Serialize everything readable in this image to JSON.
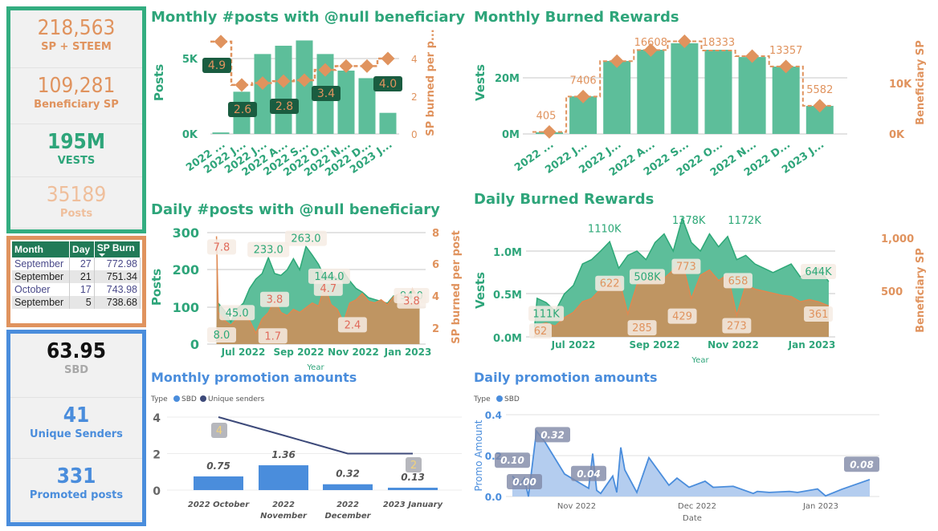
{
  "kpis_top": [
    {
      "value": "218,563",
      "label": "SP + STEEM",
      "color": "#e0935e"
    },
    {
      "value": "109,281",
      "label": "Beneficiary SP",
      "color": "#e0935e"
    },
    {
      "value": "195M",
      "label": "VESTS",
      "color": "#2ea57a"
    },
    {
      "value": "35189",
      "label": "Posts",
      "color": "#efbf9c"
    }
  ],
  "table": {
    "headers": [
      "Month",
      "Day",
      "SP Burn"
    ],
    "sort_icon": "sort-down-icon",
    "rows": [
      [
        "September",
        "27",
        "772.98"
      ],
      [
        "September",
        "21",
        "751.34"
      ],
      [
        "October",
        "17",
        "743.98"
      ],
      [
        "September",
        "5",
        "738.68"
      ]
    ]
  },
  "kpis_bottom": [
    {
      "value": "63.95",
      "label": "SBD",
      "color": "#111111",
      "label_color": "#a8a8a8"
    },
    {
      "value": "41",
      "label": "Unique Senders",
      "color": "#4a8ddc",
      "label_color": "#4a8ddc"
    },
    {
      "value": "331",
      "label": "Promoted posts",
      "color": "#4a8ddc",
      "label_color": "#4a8ddc"
    }
  ],
  "colors": {
    "green": "#5dbe9a",
    "dark_green": "#2ea57a",
    "orange": "#e0935e",
    "blue": "#4a8ddc",
    "navy": "#3d4a7a"
  },
  "chart_data": [
    {
      "type": "bar",
      "title": "Monthly #posts with @null beneficiary",
      "ylabel": "Posts",
      "y2label": "SP burned per p...",
      "categories": [
        "2022 ...",
        "2022 J...",
        "2022 J...",
        "2022 A...",
        "2022 S...",
        "2022 O...",
        "2022 N...",
        "2022 D...",
        "2023 J..."
      ],
      "yticks": [
        "0K",
        "5K"
      ],
      "y2ticks": [
        "0",
        "2",
        "4"
      ],
      "series": [
        {
          "type": "bar",
          "values_k": [
            0.1,
            2.8,
            5.3,
            5.85,
            6.2,
            5.3,
            4.2,
            3.7,
            1.4
          ]
        },
        {
          "type": "step-line",
          "axis": "right",
          "values": [
            4.9,
            2.6,
            2.7,
            2.8,
            2.85,
            3.4,
            3.6,
            3.6,
            4.0
          ],
          "labels": [
            "4.9",
            "2.6",
            null,
            "2.8",
            null,
            "3.4",
            null,
            null,
            "4.0"
          ]
        }
      ]
    },
    {
      "type": "bar",
      "title": "Monthly Burned Rewards",
      "ylabel": "Vests",
      "y2label": "Beneficiary SP",
      "categories": [
        "2022 ...",
        "2022 J...",
        "2022 J...",
        "2022 A...",
        "2022 S...",
        "2022 O...",
        "2022 N...",
        "2022 D...",
        "2023 J..."
      ],
      "yticks": [
        "0M",
        "20M"
      ],
      "y2ticks": [
        "0K",
        "10K"
      ],
      "series": [
        {
          "type": "bar",
          "values_m": [
            0.6,
            13.4,
            26,
            30,
            32.3,
            30,
            27.4,
            24,
            10
          ]
        },
        {
          "type": "step-line",
          "axis": "right",
          "values": [
            405,
            7406,
            14400,
            16608,
            18333,
            16500,
            15400,
            13357,
            5582
          ],
          "labels": [
            "405",
            "7406",
            null,
            "16608",
            null,
            "18333",
            null,
            "13357",
            "5582"
          ]
        }
      ]
    },
    {
      "type": "area",
      "title": "Daily #posts with @null beneficiary",
      "ylabel": "Posts",
      "y2label": "SP burned per post",
      "xlabel": "Year",
      "xticks": [
        "Jul 2022",
        "Sep 2022",
        "Nov 2022",
        "Jan 2023"
      ],
      "yticks": [
        "0",
        "100",
        "200",
        "300"
      ],
      "y2ticks": [
        "2",
        "4",
        "6",
        "8"
      ],
      "dates": [
        "2022-06-01",
        "2022-06-03",
        "2022-06-10",
        "2022-06-17",
        "2022-06-24",
        "2022-07-01",
        "2022-07-08",
        "2022-07-15",
        "2022-07-22",
        "2022-07-29",
        "2022-08-05",
        "2022-08-12",
        "2022-08-19",
        "2022-08-26",
        "2022-09-02",
        "2022-09-09",
        "2022-09-16",
        "2022-09-23",
        "2022-09-30",
        "2022-10-07",
        "2022-10-14",
        "2022-10-21",
        "2022-10-28",
        "2022-11-04",
        "2022-11-11",
        "2022-11-18",
        "2022-11-25",
        "2022-12-02",
        "2022-12-09",
        "2022-12-16",
        "2022-12-23",
        "2022-12-30",
        "2023-01-06",
        "2023-01-14"
      ],
      "series": [
        {
          "name": "Posts",
          "values": [
            8,
            110,
            90,
            60,
            95,
            110,
            150,
            175,
            190,
            233,
            190,
            185,
            200,
            230,
            200,
            263,
            240,
            215,
            180,
            190,
            175,
            195,
            170,
            150,
            140,
            125,
            120,
            115,
            110,
            130,
            120,
            110,
            100,
            94
          ]
        },
        {
          "name": "SP burned per post",
          "axis": "right",
          "values": [
            7.8,
            3.0,
            2.5,
            2.2,
            2.6,
            2.8,
            2.5,
            1.7,
            2.6,
            3.0,
            3.8,
            3.0,
            2.8,
            3.2,
            3.0,
            3.3,
            3.6,
            3.4,
            4.7,
            3.5,
            3.2,
            2.4,
            3.6,
            3.8,
            4.2,
            3.7,
            3.6,
            3.8,
            3.5,
            4.0,
            4.2,
            3.6,
            4.5,
            3.8
          ]
        }
      ],
      "data_labels": [
        {
          "series": 0,
          "date": "2022-06-03",
          "value": 15,
          "text": "8.0"
        },
        {
          "series": 0,
          "date": "2022-06-24",
          "value": 75,
          "text": "45.0"
        },
        {
          "series": 0,
          "date": "2022-07-29",
          "value": 245,
          "text": "233.0"
        },
        {
          "series": 0,
          "date": "2022-09-09",
          "value": 275,
          "text": "263.0"
        },
        {
          "series": 0,
          "date": "2022-10-05",
          "value": 173,
          "text": "144.0"
        },
        {
          "series": 0,
          "date": "2023-01-05",
          "value": 121,
          "text": "94.0"
        },
        {
          "series": 1,
          "date": "2022-06-03",
          "value": 6.9,
          "text": "7.8"
        },
        {
          "series": 1,
          "date": "2022-08-03",
          "value": 1.3,
          "text": "1.7"
        },
        {
          "series": 1,
          "date": "2022-08-05",
          "value": 3.6,
          "text": "3.8"
        },
        {
          "series": 1,
          "date": "2022-10-04",
          "value": 4.3,
          "text": "4.7"
        },
        {
          "series": 1,
          "date": "2022-10-31",
          "value": 2.0,
          "text": "2.4"
        },
        {
          "series": 1,
          "date": "2023-01-05",
          "value": 3.5,
          "text": "3.8"
        }
      ]
    },
    {
      "type": "area",
      "title": "Daily Burned Rewards",
      "ylabel": "Vests",
      "y2label": "Beneficiary SP",
      "xlabel": "Year",
      "xticks": [
        "Jul 2022",
        "Sep 2022",
        "Nov 2022",
        "Jan 2023"
      ],
      "yticks": [
        "0.0M",
        "0.5M",
        "1.0M"
      ],
      "y2ticks": [
        "500",
        "1,000"
      ],
      "dates": [
        "2022-06-01",
        "2022-06-03",
        "2022-06-10",
        "2022-06-17",
        "2022-06-24",
        "2022-07-01",
        "2022-07-08",
        "2022-07-15",
        "2022-07-22",
        "2022-07-29",
        "2022-08-05",
        "2022-08-12",
        "2022-08-19",
        "2022-08-26",
        "2022-09-02",
        "2022-09-09",
        "2022-09-16",
        "2022-09-23",
        "2022-09-30",
        "2022-10-07",
        "2022-10-14",
        "2022-10-21",
        "2022-10-28",
        "2022-11-04",
        "2022-11-11",
        "2022-11-18",
        "2022-11-25",
        "2022-12-02",
        "2022-12-09",
        "2022-12-16",
        "2022-12-23",
        "2022-12-30",
        "2023-01-06",
        "2023-01-14"
      ],
      "series": [
        {
          "name": "Vests",
          "unit": "M",
          "values": [
            0.11,
            0.45,
            0.4,
            0.3,
            0.5,
            0.6,
            0.85,
            0.9,
            1.0,
            1.11,
            0.8,
            0.95,
            1.0,
            0.9,
            1.1,
            1.2,
            1.0,
            1.38,
            1.1,
            1.0,
            1.2,
            1.05,
            1.17,
            0.9,
            0.95,
            0.85,
            0.8,
            0.75,
            0.8,
            0.85,
            0.7,
            0.75,
            0.8,
            0.644
          ]
        },
        {
          "name": "Beneficiary SP",
          "axis": "right",
          "values": [
            62,
            180,
            200,
            170,
            250,
            300,
            400,
            430,
            520,
            580,
            622,
            285,
            560,
            600,
            650,
            620,
            700,
            773,
            429,
            650,
            700,
            600,
            658,
            273,
            560,
            520,
            500,
            480,
            460,
            450,
            400,
            420,
            400,
            361
          ]
        }
      ],
      "data_labels": [
        {
          "series": 0,
          "date": "2022-06-10",
          "value": 0.23,
          "text": "111K"
        },
        {
          "series": 0,
          "date": "2022-07-25",
          "value": 1.22,
          "text": "1110K"
        },
        {
          "series": 0,
          "date": "2022-08-27",
          "value": 0.66,
          "text": "508K"
        },
        {
          "series": 0,
          "date": "2022-09-28",
          "value": 1.32,
          "text": "1378K"
        },
        {
          "series": 0,
          "date": "2022-11-10",
          "value": 1.32,
          "text": "1172K"
        },
        {
          "series": 0,
          "date": "2023-01-06",
          "value": 0.72,
          "text": "644K"
        },
        {
          "series": 1,
          "date": "2022-06-03",
          "value": 90,
          "text": "62"
        },
        {
          "series": 1,
          "date": "2022-07-29",
          "value": 540,
          "text": "622"
        },
        {
          "series": 1,
          "date": "2022-08-23",
          "value": 120,
          "text": "285"
        },
        {
          "series": 1,
          "date": "2022-09-23",
          "value": 230,
          "text": "429"
        },
        {
          "series": 1,
          "date": "2022-09-26",
          "value": 700,
          "text": "773"
        },
        {
          "series": 1,
          "date": "2022-11-04",
          "value": 140,
          "text": "273"
        },
        {
          "series": 1,
          "date": "2022-11-05",
          "value": 565,
          "text": "658"
        },
        {
          "series": 1,
          "date": "2023-01-06",
          "value": 250,
          "text": "361"
        }
      ]
    },
    {
      "type": "bar",
      "title": "Monthly promotion amounts",
      "legend_title": "Type",
      "legend": [
        "SBD",
        "Unique senders"
      ],
      "categories": [
        "2022 October",
        "2022 November",
        "2022 December",
        "2023 January"
      ],
      "yticks": [
        "0",
        "2",
        "4"
      ],
      "series": [
        {
          "name": "SBD",
          "type": "bar",
          "values": [
            0.75,
            1.36,
            0.32,
            0.13
          ],
          "labels": [
            "0.75",
            "1.36",
            "0.32",
            "0.13"
          ]
        },
        {
          "name": "Unique senders",
          "type": "line",
          "values": [
            4,
            3,
            2,
            2
          ],
          "labels": [
            "4",
            null,
            null,
            "2"
          ]
        }
      ]
    },
    {
      "type": "area",
      "title": "Daily promotion amounts",
      "legend_title": "Type",
      "legend": [
        "SBD"
      ],
      "ylabel": "Promo Amount",
      "xlabel": "Date",
      "xticks": [
        "Nov 2022",
        "Dec 2022",
        "Jan 2023"
      ],
      "yticks": [
        "0.0",
        "0.2",
        "0.4"
      ],
      "series": [
        {
          "name": "SBD",
          "points": [
            [
              "2022-10-16",
              0.1
            ],
            [
              "2022-10-18",
              0.06
            ],
            [
              "2022-10-19",
              0.09
            ],
            [
              "2022-10-20",
              0.0
            ],
            [
              "2022-10-22",
              0.32
            ],
            [
              "2022-10-24",
              0.27
            ],
            [
              "2022-10-29",
              0.11
            ],
            [
              "2022-11-04",
              0.04
            ],
            [
              "2022-11-05",
              0.21
            ],
            [
              "2022-11-06",
              0.03
            ],
            [
              "2022-11-07",
              0.015
            ],
            [
              "2022-11-10",
              0.1
            ],
            [
              "2022-11-11",
              0.02
            ],
            [
              "2022-11-12",
              0.24
            ],
            [
              "2022-11-13",
              0.13
            ],
            [
              "2022-11-16",
              0.02
            ],
            [
              "2022-11-19",
              0.19
            ],
            [
              "2022-11-24",
              0.055
            ],
            [
              "2022-11-26",
              0.09
            ],
            [
              "2022-11-29",
              0.045
            ],
            [
              "2022-12-03",
              0.075
            ],
            [
              "2022-12-05",
              0.045
            ],
            [
              "2022-12-10",
              0.05
            ],
            [
              "2022-12-15",
              0.015
            ],
            [
              "2022-12-16",
              0.025
            ],
            [
              "2022-12-19",
              0.02
            ],
            [
              "2022-12-24",
              0.025
            ],
            [
              "2022-12-26",
              0.02
            ],
            [
              "2022-12-31",
              0.037
            ],
            [
              "2023-01-02",
              0.003
            ],
            [
              "2023-01-06",
              0.035
            ],
            [
              "2023-01-13",
              0.083
            ]
          ]
        }
      ],
      "data_labels": [
        {
          "date": "2022-10-16",
          "value": 0.16,
          "text": "0.10"
        },
        {
          "date": "2022-10-19",
          "value": 0.055,
          "text": "0.00"
        },
        {
          "date": "2022-10-26",
          "value": 0.285,
          "text": "0.32"
        },
        {
          "date": "2022-11-04",
          "value": 0.095,
          "text": "0.04"
        },
        {
          "date": "2023-01-11",
          "value": 0.14,
          "text": "0.08"
        }
      ]
    }
  ]
}
